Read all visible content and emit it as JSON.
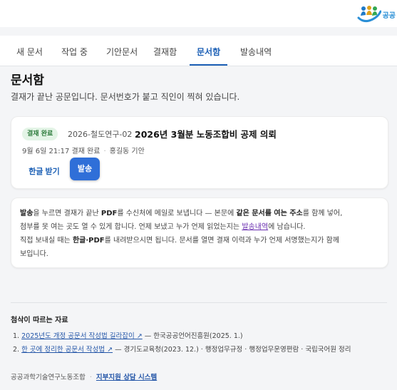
{
  "brand": {
    "logo_text": "공공"
  },
  "tabs": [
    {
      "label": "새 문서"
    },
    {
      "label": "작업 중"
    },
    {
      "label": "기안문서"
    },
    {
      "label": "결재함"
    },
    {
      "label": "문서함"
    },
    {
      "label": "발송내역"
    }
  ],
  "active_tab": "문서함",
  "page": {
    "title": "문서함",
    "description": "결재가 끝난 공문입니다. 문서번호가 붙고 직인이 찍혀 있습니다."
  },
  "document": {
    "status_badge": "결재 완료",
    "doc_number": "2026-철도연구-02",
    "title": "2026년 3월분 노동조합비 공제 의뢰",
    "approved_at": "9월 6일 21:17 결재 완료",
    "drafter": "홍길동 기안",
    "download_label": "한글 받기",
    "send_label": "발송"
  },
  "notice": {
    "l1_a": "발송",
    "l1_b": "을 누르면 결재가 끝난 ",
    "l1_c": "PDF",
    "l1_d": "를 수신처에 메일로 보냅니다 — 본문에 ",
    "l1_e": "같은 문서를 여는 주소",
    "l1_f": "를 함께 넣어,",
    "l2_a": "첨부를 못 여는 곳도 열 수 있게 합니다. 언제 보냈고 누가 언제 읽었는지는 ",
    "l2_link": "발송내역",
    "l2_b": "에 남습니다.",
    "l3_a": "직접 보내실 때는 ",
    "l3_b": "한글·PDF",
    "l3_c": "를 내려받으시면 됩니다. 문서를 열면 결재 이력과 누가 언제 서명했는지가 함께",
    "l4": "보입니다."
  },
  "references": {
    "title": "첨삭이 따르는 자료",
    "items": [
      {
        "num": "1.",
        "link": "2025년도 개정 공문서 작성법 길라잡이 ↗",
        "source": " — 한국공공언어진흥원(2025. 1.)"
      },
      {
        "num": "2.",
        "link": "한 곳에 정리한 공문서 작성법 ↗",
        "source": " — 경기도교육청(2023. 12.) · 행정업무규정 · 행정업무운영편람 · 국립국어원 정리"
      }
    ]
  },
  "footer": {
    "org": "공공과학기술연구노동조합",
    "link": "지부지원 상담 시스템"
  },
  "colors": {
    "accent": "#1b5fb5",
    "send_button": "#2f6fd8",
    "badge_bg": "#e3f4e6",
    "badge_text": "#2b7a3a"
  }
}
